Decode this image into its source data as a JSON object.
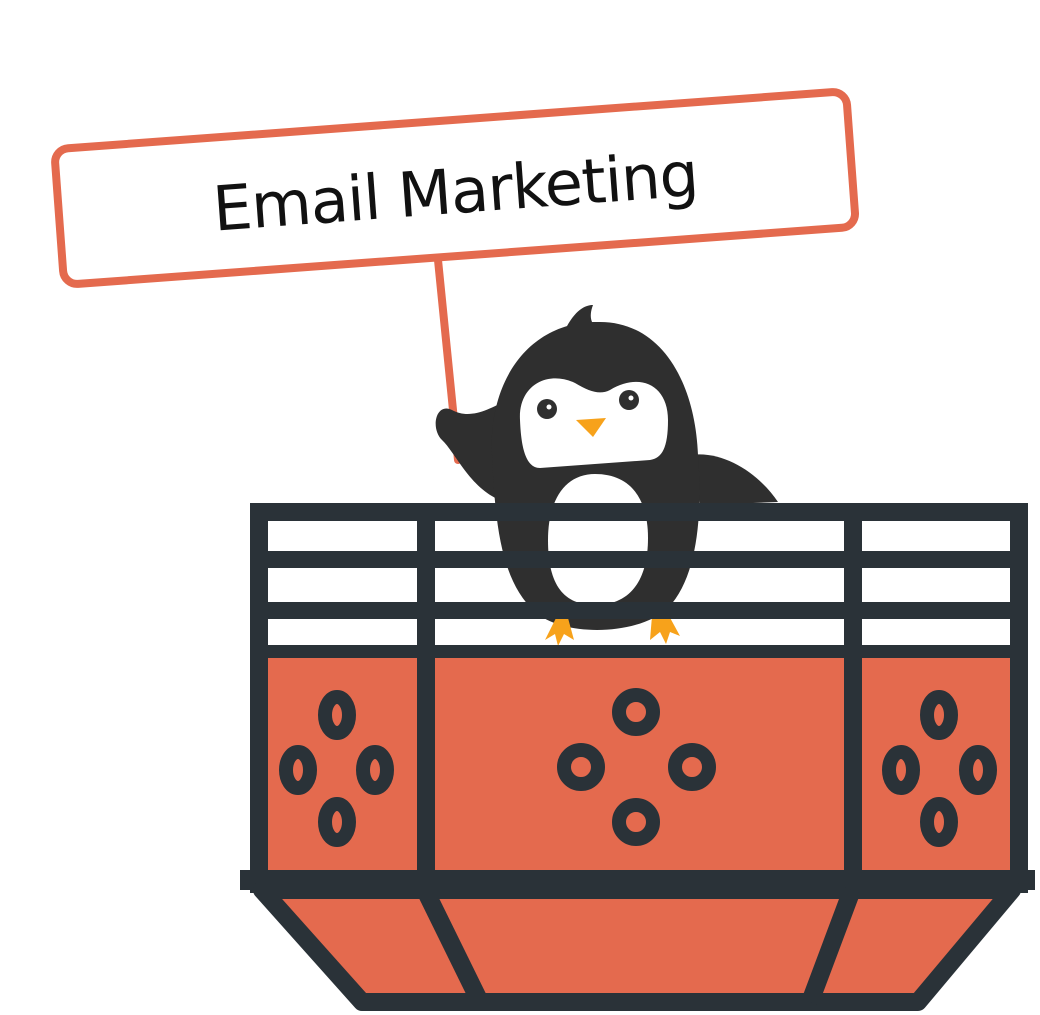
{
  "sign": {
    "text": "Email Marketing"
  },
  "colors": {
    "accent": "#E46A4E",
    "dark": "#2A3238",
    "penguin_body": "#2F2F2F",
    "beak_feet": "#F7A21B",
    "background": "#FFFFFF"
  },
  "icons": [
    "penguin-mascot",
    "balcony-basket",
    "email-sign"
  ]
}
